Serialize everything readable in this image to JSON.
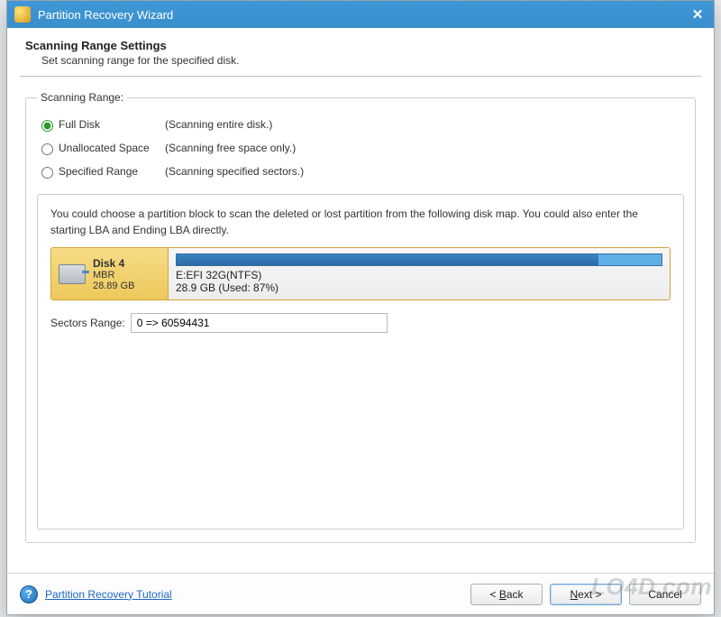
{
  "window": {
    "title": "Partition Recovery Wizard"
  },
  "header": {
    "title": "Scanning Range Settings",
    "subtitle": "Set scanning range for the specified disk."
  },
  "scanning_range": {
    "legend": "Scanning Range:",
    "options": [
      {
        "label": "Full Disk",
        "desc": "(Scanning entire disk.)",
        "checked": true
      },
      {
        "label": "Unallocated Space",
        "desc": "(Scanning free space only.)",
        "checked": false
      },
      {
        "label": "Specified Range",
        "desc": "(Scanning specified sectors.)",
        "checked": false
      }
    ]
  },
  "disk_map": {
    "instructions": "You could choose a partition block to scan the deleted or lost partition from the following disk map. You could also enter the starting LBA and Ending LBA directly.",
    "disk": {
      "name": "Disk 4",
      "type": "MBR",
      "size": "28.89 GB"
    },
    "partition": {
      "label": "E:EFI 32G(NTFS)",
      "usage_text": "28.9 GB (Used: 87%)",
      "used_pct": 87
    },
    "sectors": {
      "label": "Sectors Range:",
      "value": "0 => 60594431"
    }
  },
  "footer": {
    "tutorial": "Partition Recovery Tutorial",
    "back": "< Back",
    "next": "Next >",
    "cancel": "Cancel"
  },
  "watermark": "LO4D.com"
}
